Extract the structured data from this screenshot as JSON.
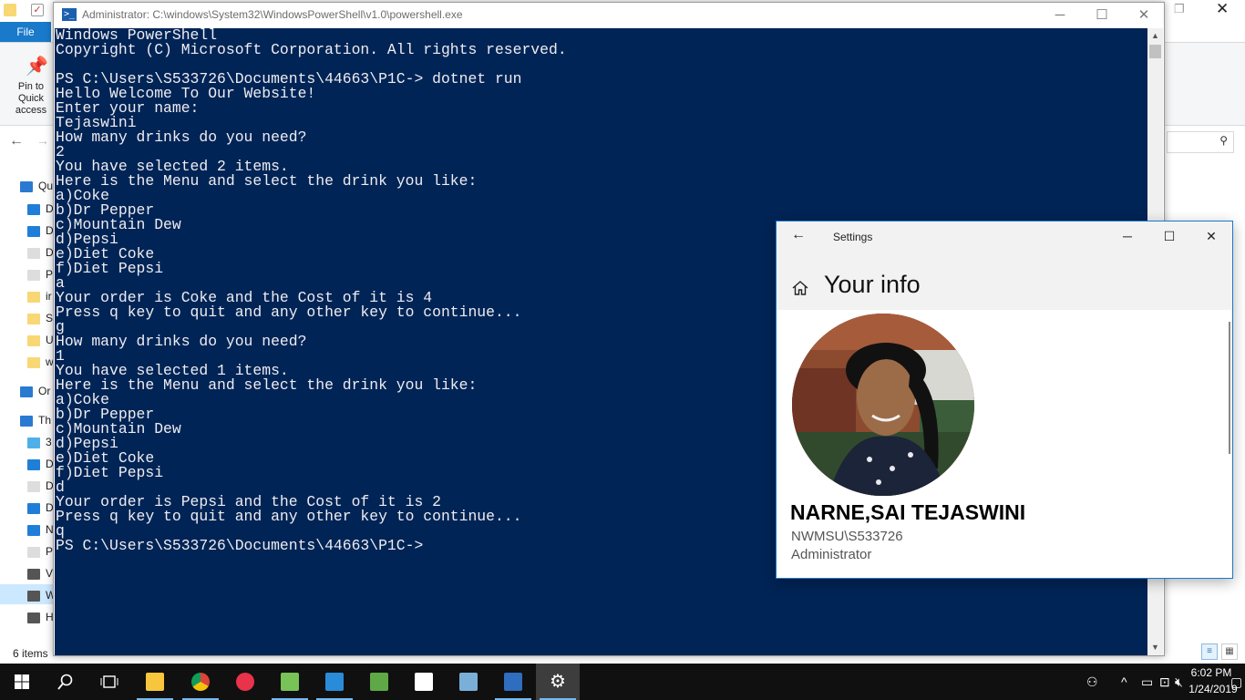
{
  "explorer": {
    "file_tab": "File",
    "pin_label": "Pin to Quick access",
    "status": "6 items",
    "nav_items": [
      {
        "label": "Qu",
        "color": "#2a7ad2"
      },
      {
        "label": "D",
        "color": "#1f7fd8"
      },
      {
        "label": "D",
        "color": "#1f7fd8"
      },
      {
        "label": "D",
        "color": "#dddddd"
      },
      {
        "label": "P",
        "color": "#dddddd"
      },
      {
        "label": "ir",
        "color": "#f8d775"
      },
      {
        "label": "S",
        "color": "#f8d775"
      },
      {
        "label": "U",
        "color": "#f8d775"
      },
      {
        "label": "w",
        "color": "#f8d775"
      },
      {
        "label": "Or",
        "color": "#2a7ad2"
      },
      {
        "label": "Th",
        "color": "#2a7ad2"
      },
      {
        "label": "3",
        "color": "#4fb0e8"
      },
      {
        "label": "D",
        "color": "#1f7fd8"
      },
      {
        "label": "D",
        "color": "#dddddd"
      },
      {
        "label": "D",
        "color": "#1f7fd8"
      },
      {
        "label": "N",
        "color": "#1f7fd8"
      },
      {
        "label": "P",
        "color": "#dddddd"
      },
      {
        "label": "V",
        "color": "#555555"
      },
      {
        "label": "W",
        "color": "#555555"
      },
      {
        "label": "H",
        "color": "#555555"
      }
    ]
  },
  "powershell": {
    "title": "Administrator: C:\\windows\\System32\\WindowsPowerShell\\v1.0\\powershell.exe",
    "lines": [
      "Windows PowerShell",
      "Copyright (C) Microsoft Corporation. All rights reserved.",
      "",
      "PS C:\\Users\\S533726\\Documents\\44663\\P1C-> dotnet run",
      "Hello Welcome To Our Website!",
      "Enter your name:",
      "Tejaswini",
      "How many drinks do you need?",
      "2",
      "You have selected 2 items.",
      "Here is the Menu and select the drink you like:",
      "a)Coke",
      "b)Dr Pepper",
      "c)Mountain Dew",
      "d)Pepsi",
      "e)Diet Coke",
      "f)Diet Pepsi",
      "a",
      "Your order is Coke and the Cost of it is 4",
      "Press q key to quit and any other key to continue...",
      "g",
      "How many drinks do you need?",
      "1",
      "You have selected 1 items.",
      "Here is the Menu and select the drink you like:",
      "a)Coke",
      "b)Dr Pepper",
      "c)Mountain Dew",
      "d)Pepsi",
      "e)Diet Coke",
      "f)Diet Pepsi",
      "d",
      "Your order is Pepsi and the Cost of it is 2",
      "Press q key to quit and any other key to continue...",
      "q",
      "PS C:\\Users\\S533726\\Documents\\44663\\P1C->"
    ],
    "background": "#012456"
  },
  "settings": {
    "title": "Settings",
    "heading": "Your info",
    "user_name": "NARNE,SAI TEJASWINI",
    "account": "NWMSU\\S533726",
    "role": "Administrator"
  },
  "taskbar": {
    "time": "6:02 PM",
    "date": "1/24/2019",
    "apps": [
      {
        "name": "file-explorer",
        "color": "#f8c63d"
      },
      {
        "name": "chrome",
        "color": "#4285f4"
      },
      {
        "name": "app-red",
        "color": "#e8334a"
      },
      {
        "name": "android-studio",
        "color": "#78c257"
      },
      {
        "name": "visual-studio-code",
        "color": "#2a8cd8"
      },
      {
        "name": "app-green",
        "color": "#5fa846"
      },
      {
        "name": "photos",
        "color": "#ffffff"
      },
      {
        "name": "app-blue",
        "color": "#7ab0d8"
      },
      {
        "name": "powershell",
        "color": "#2f6dbf"
      },
      {
        "name": "settings",
        "color": "#ffffff"
      }
    ]
  }
}
